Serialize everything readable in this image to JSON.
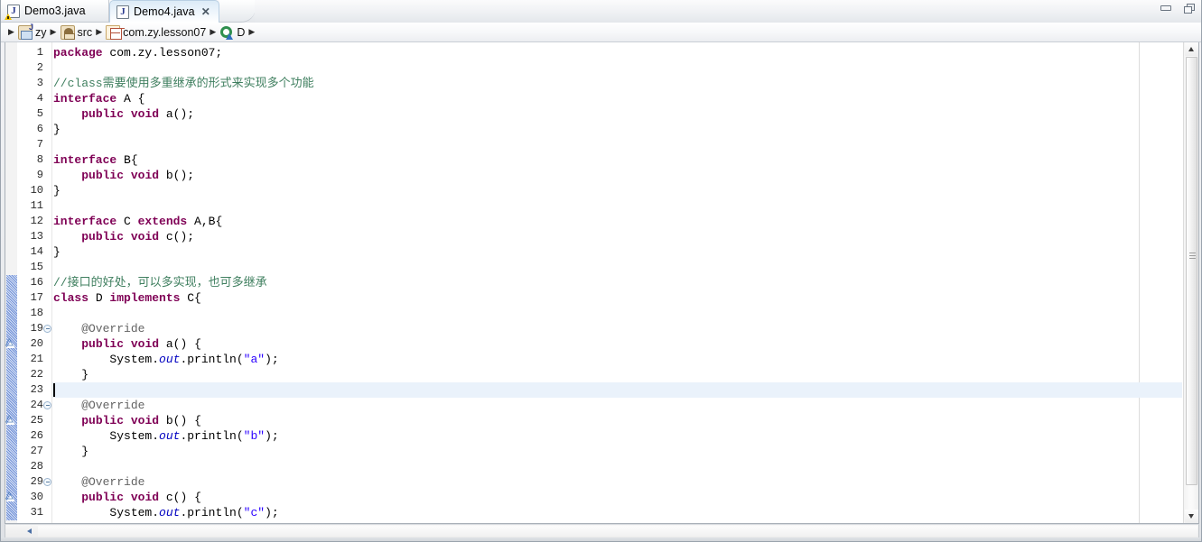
{
  "window": {
    "buttons": [
      {
        "name": "minimize",
        "label": "Minimize"
      },
      {
        "name": "restore",
        "label": "Restore"
      }
    ]
  },
  "tabs": [
    {
      "label": "Demo3.java",
      "icon": "java-file-icon",
      "active": false,
      "has_warning": true,
      "closable": false,
      "close_label": ""
    },
    {
      "label": "Demo4.java",
      "icon": "java-file-icon",
      "active": true,
      "has_warning": false,
      "closable": true,
      "close_label": "✕"
    }
  ],
  "breadcrumb": {
    "separator": "▶",
    "items": [
      {
        "label": "zy",
        "icon": "java-project-icon"
      },
      {
        "label": "src",
        "icon": "source-folder-icon"
      },
      {
        "label": "com.zy.lesson07",
        "icon": "package-icon"
      },
      {
        "label": "D",
        "icon": "class-icon"
      }
    ]
  },
  "editor": {
    "first_line": 1,
    "last_visible_line": 31,
    "current_line": 23,
    "caret_line": 23,
    "caret_column": 1,
    "change_bar_from": 16,
    "change_bar_to": 31,
    "fold_collapse_lines": [
      19,
      24,
      29
    ],
    "override_marker_lines": [
      20,
      25,
      30
    ],
    "colors": {
      "keyword": "#7f0055",
      "comment": "#3f7f5f",
      "string": "#2a00ff",
      "annotation": "#646464",
      "static_field": "#0000c0",
      "plain": "#000000",
      "current_line_highlight": "#eaf2fb",
      "change_bar": "#6f8fd6",
      "background": "#ffffff"
    },
    "lines": [
      {
        "n": 1,
        "tokens": [
          {
            "t": "package",
            "c": "kw"
          },
          {
            "t": " com.zy.lesson07;",
            "c": "pln"
          }
        ]
      },
      {
        "n": 2,
        "tokens": []
      },
      {
        "n": 3,
        "tokens": [
          {
            "t": "//class需要使用多重继承的形式来实现多个功能",
            "c": "cmt"
          }
        ]
      },
      {
        "n": 4,
        "tokens": [
          {
            "t": "interface",
            "c": "kw"
          },
          {
            "t": " A {",
            "c": "pln"
          }
        ]
      },
      {
        "n": 5,
        "tokens": [
          {
            "t": "    ",
            "c": "pln"
          },
          {
            "t": "public",
            "c": "kw"
          },
          {
            "t": " ",
            "c": "pln"
          },
          {
            "t": "void",
            "c": "kw"
          },
          {
            "t": " a();",
            "c": "pln"
          }
        ]
      },
      {
        "n": 6,
        "tokens": [
          {
            "t": "}",
            "c": "pln"
          }
        ]
      },
      {
        "n": 7,
        "tokens": []
      },
      {
        "n": 8,
        "tokens": [
          {
            "t": "interface",
            "c": "kw"
          },
          {
            "t": " B{",
            "c": "pln"
          }
        ]
      },
      {
        "n": 9,
        "tokens": [
          {
            "t": "    ",
            "c": "pln"
          },
          {
            "t": "public",
            "c": "kw"
          },
          {
            "t": " ",
            "c": "pln"
          },
          {
            "t": "void",
            "c": "kw"
          },
          {
            "t": " b();",
            "c": "pln"
          }
        ]
      },
      {
        "n": 10,
        "tokens": [
          {
            "t": "}",
            "c": "pln"
          }
        ]
      },
      {
        "n": 11,
        "tokens": []
      },
      {
        "n": 12,
        "tokens": [
          {
            "t": "interface",
            "c": "kw"
          },
          {
            "t": " C ",
            "c": "pln"
          },
          {
            "t": "extends",
            "c": "kw"
          },
          {
            "t": " A,B{",
            "c": "pln"
          }
        ]
      },
      {
        "n": 13,
        "tokens": [
          {
            "t": "    ",
            "c": "pln"
          },
          {
            "t": "public",
            "c": "kw"
          },
          {
            "t": " ",
            "c": "pln"
          },
          {
            "t": "void",
            "c": "kw"
          },
          {
            "t": " c();",
            "c": "pln"
          }
        ]
      },
      {
        "n": 14,
        "tokens": [
          {
            "t": "}",
            "c": "pln"
          }
        ]
      },
      {
        "n": 15,
        "tokens": []
      },
      {
        "n": 16,
        "tokens": [
          {
            "t": "//接口的好处，可以多实现，也可多继承",
            "c": "cmt"
          }
        ]
      },
      {
        "n": 17,
        "tokens": [
          {
            "t": "class",
            "c": "kw"
          },
          {
            "t": " D ",
            "c": "pln"
          },
          {
            "t": "implements",
            "c": "kw"
          },
          {
            "t": " C{",
            "c": "pln"
          }
        ]
      },
      {
        "n": 18,
        "tokens": []
      },
      {
        "n": 19,
        "tokens": [
          {
            "t": "    @Override",
            "c": "ann"
          }
        ]
      },
      {
        "n": 20,
        "tokens": [
          {
            "t": "    ",
            "c": "pln"
          },
          {
            "t": "public",
            "c": "kw"
          },
          {
            "t": " ",
            "c": "pln"
          },
          {
            "t": "void",
            "c": "kw"
          },
          {
            "t": " a() {",
            "c": "pln"
          }
        ]
      },
      {
        "n": 21,
        "tokens": [
          {
            "t": "        System.",
            "c": "pln"
          },
          {
            "t": "out",
            "c": "fld"
          },
          {
            "t": ".println(",
            "c": "pln"
          },
          {
            "t": "\"a\"",
            "c": "str"
          },
          {
            "t": ");",
            "c": "pln"
          }
        ]
      },
      {
        "n": 22,
        "tokens": [
          {
            "t": "    }",
            "c": "pln"
          }
        ]
      },
      {
        "n": 23,
        "tokens": []
      },
      {
        "n": 24,
        "tokens": [
          {
            "t": "    @Override",
            "c": "ann"
          }
        ]
      },
      {
        "n": 25,
        "tokens": [
          {
            "t": "    ",
            "c": "pln"
          },
          {
            "t": "public",
            "c": "kw"
          },
          {
            "t": " ",
            "c": "pln"
          },
          {
            "t": "void",
            "c": "kw"
          },
          {
            "t": " b() {",
            "c": "pln"
          }
        ]
      },
      {
        "n": 26,
        "tokens": [
          {
            "t": "        System.",
            "c": "pln"
          },
          {
            "t": "out",
            "c": "fld"
          },
          {
            "t": ".println(",
            "c": "pln"
          },
          {
            "t": "\"b\"",
            "c": "str"
          },
          {
            "t": ");",
            "c": "pln"
          }
        ]
      },
      {
        "n": 27,
        "tokens": [
          {
            "t": "    }",
            "c": "pln"
          }
        ]
      },
      {
        "n": 28,
        "tokens": []
      },
      {
        "n": 29,
        "tokens": [
          {
            "t": "    @Override",
            "c": "ann"
          }
        ]
      },
      {
        "n": 30,
        "tokens": [
          {
            "t": "    ",
            "c": "pln"
          },
          {
            "t": "public",
            "c": "kw"
          },
          {
            "t": " ",
            "c": "pln"
          },
          {
            "t": "void",
            "c": "kw"
          },
          {
            "t": " c() {",
            "c": "pln"
          }
        ]
      },
      {
        "n": 31,
        "tokens": [
          {
            "t": "        System.",
            "c": "pln"
          },
          {
            "t": "out",
            "c": "fld"
          },
          {
            "t": ".println(",
            "c": "pln"
          },
          {
            "t": "\"c\"",
            "c": "str"
          },
          {
            "t": ");",
            "c": "pln"
          }
        ]
      }
    ]
  },
  "scrollbars": {
    "vertical": {
      "up_arrow": "▲",
      "down_arrow": "▼",
      "thumb_visible": true
    },
    "horizontal": {
      "left_arrow": "◀",
      "thumb_visible": false
    }
  }
}
